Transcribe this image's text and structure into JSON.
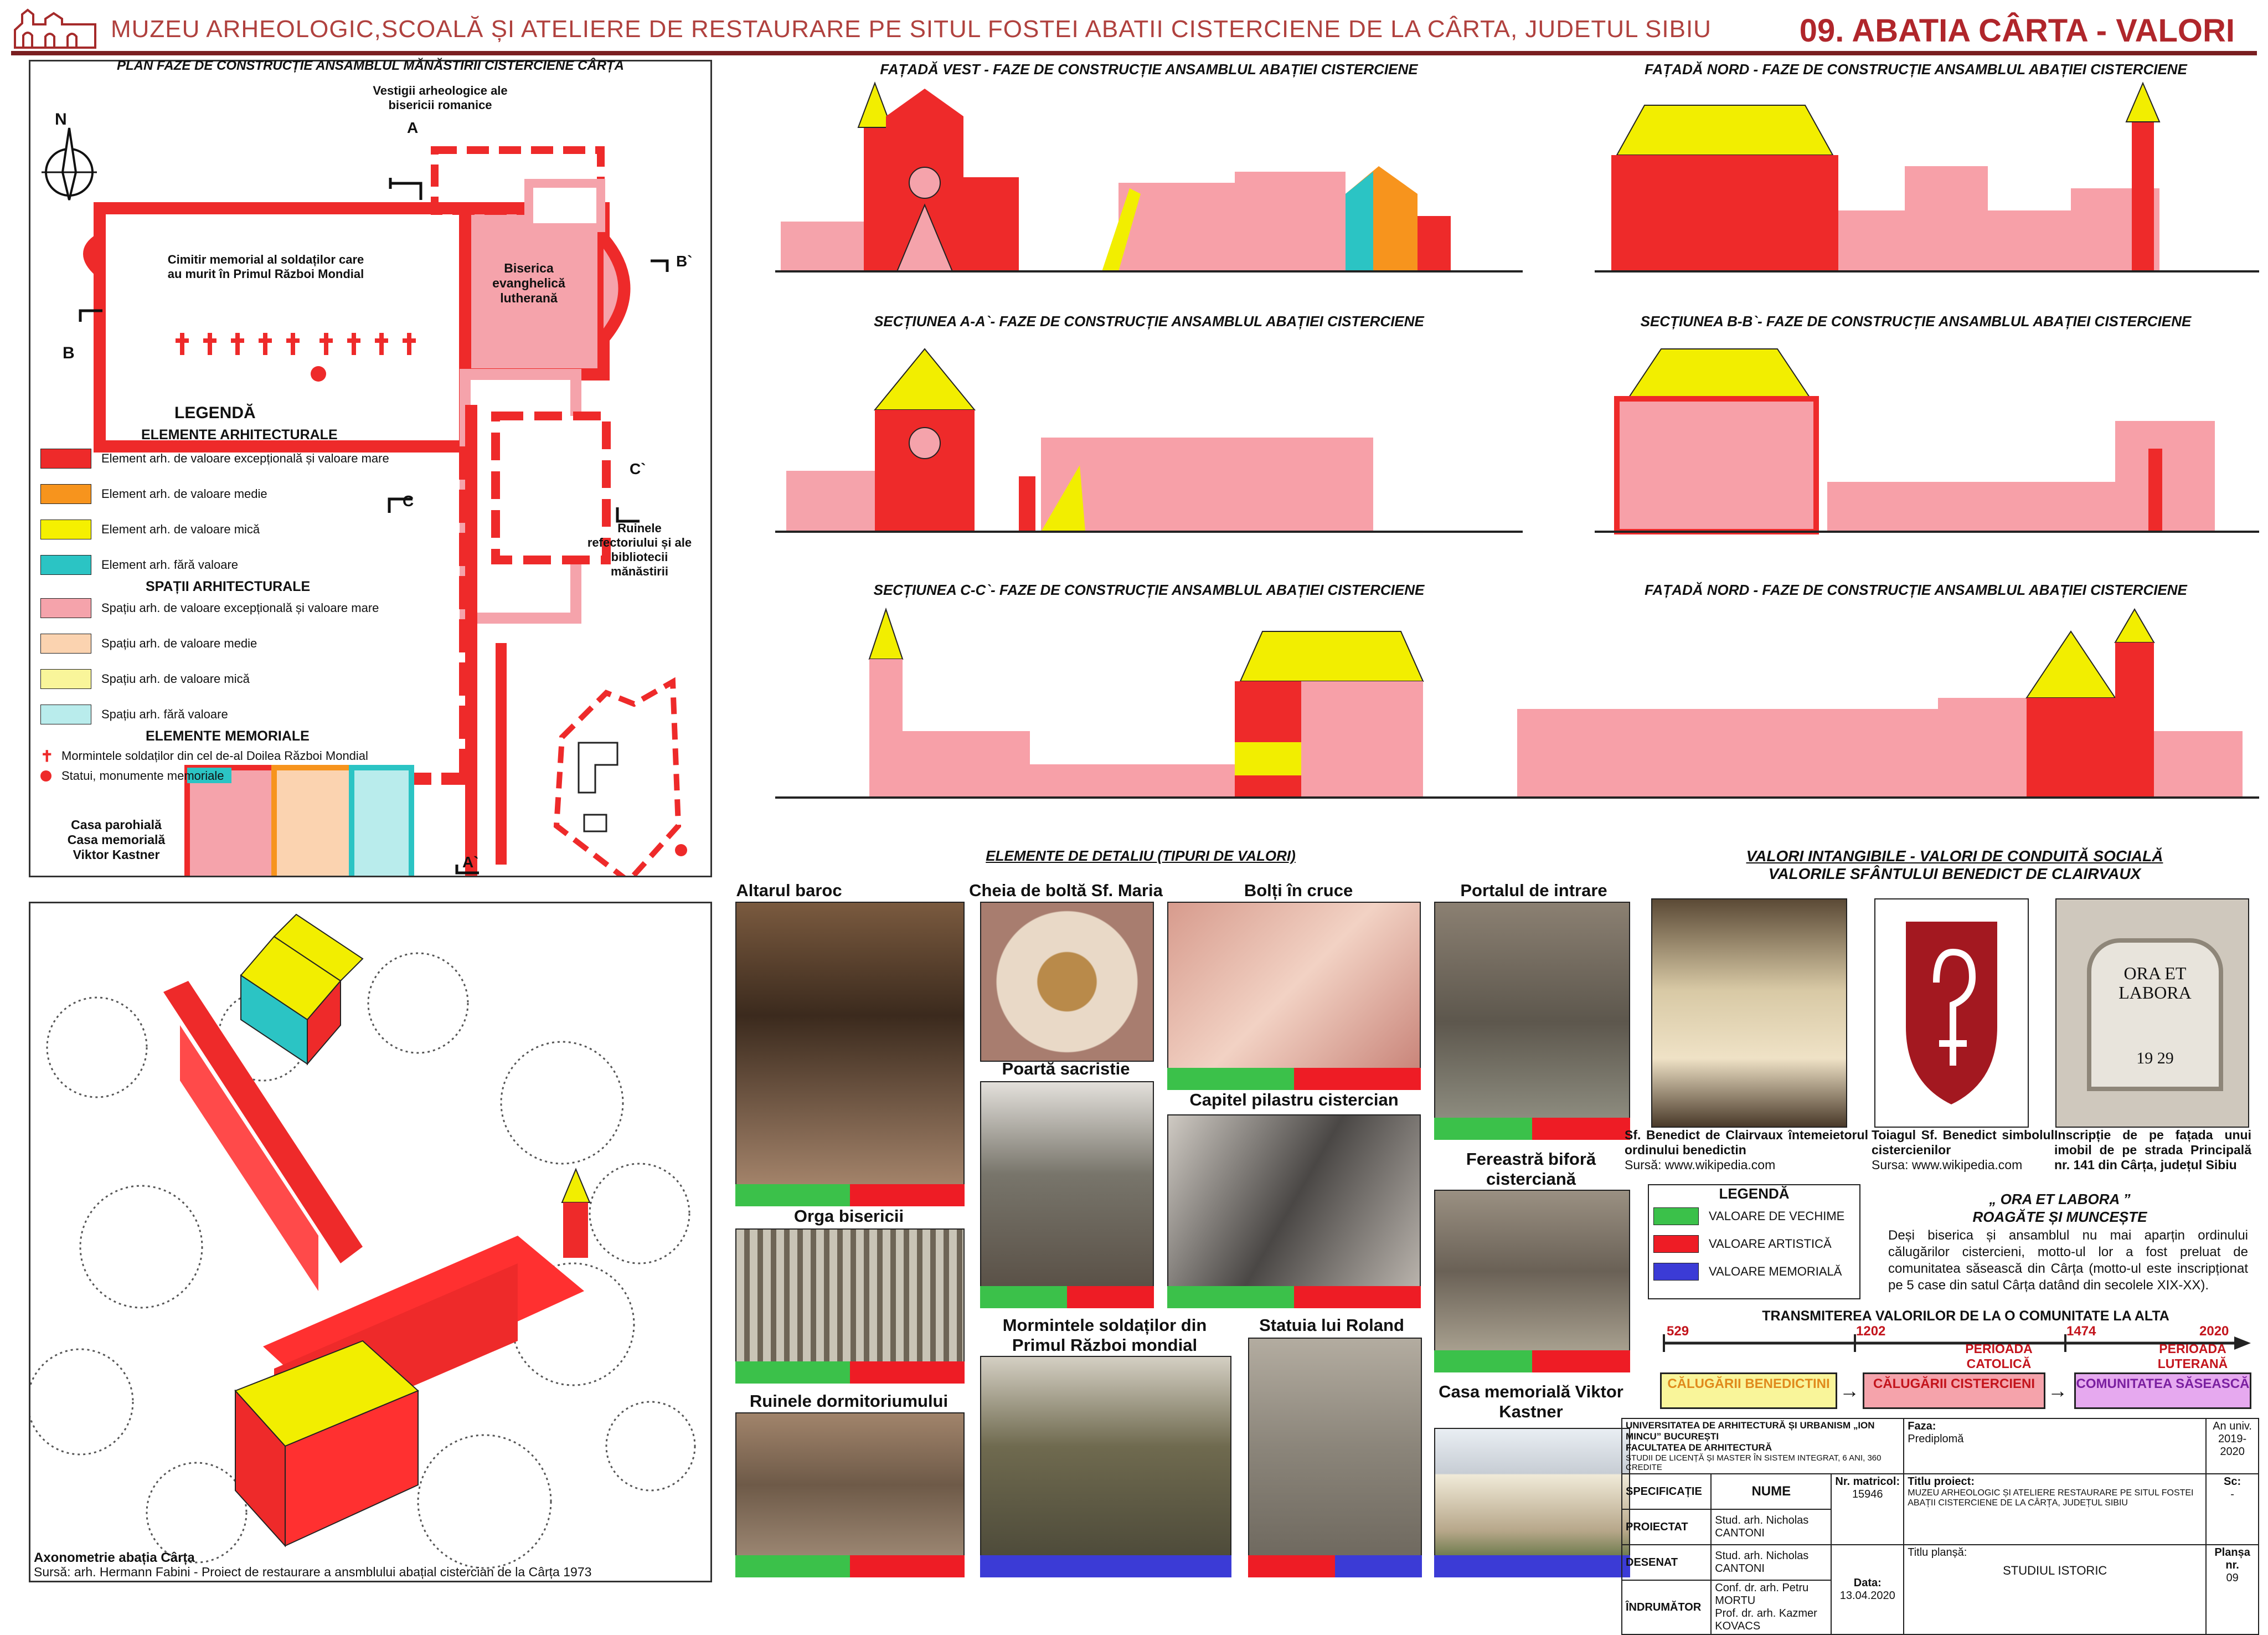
{
  "header": {
    "title": "MUZEU ARHEOLOGIC,SCOALĂ ȘI ATELIERE DE RESTAURARE PE SITUL FOSTEI ABATII CISTERCIENE DE LA CÂRTA, JUDETUL SIBIU",
    "sheet": "09. ABATIA CÂRTA - VALORI"
  },
  "plan": {
    "title": "PLAN FAZE DE CONSTRUCȚIE  ANSAMBLUL MĂNĂSTIRII CISTERCIENE CÂRȚA",
    "vestigii": "Vestigii arheologice ale bisericii romanice",
    "cimitir": "Cimitir memorial al soldaților care au murit  în Primul Război Mondial",
    "biserica": "Biserica evanghelică lutherană",
    "ruinele": "Ruinele refectoriului și ale bibliotecii mănăstirii",
    "casa": "Casa parohială\nCasa memorială\nViktor Kastner",
    "north": "N",
    "cut_a": "A",
    "cut_a2": "A`",
    "cut_b": "B",
    "cut_b2": "B`",
    "cut_c": "C",
    "cut_c2": "C`"
  },
  "legend": {
    "title": "LEGENDĂ",
    "section1": "ELEMENTE ARHITECTURALE",
    "section2": "SPAȚII ARHITECTURALE",
    "section3": "ELEMENTE MEMORIALE",
    "items": [
      {
        "label": "Element arh. de valoare excepțională și valoare mare",
        "color": "#ee2a2a"
      },
      {
        "label": "Element arh. de valoare medie",
        "color": "#f7941d"
      },
      {
        "label": "Element arh. de valoare mică",
        "color": "#f5f000"
      },
      {
        "label": "Element arh. fără valoare",
        "color": "#2bc4c4"
      },
      {
        "label": "Spațiu arh. de valoare excepțională și valoare mare",
        "color": "#f5a3ab"
      },
      {
        "label": "Spațiu arh. de valoare medie",
        "color": "#fbd3b0"
      },
      {
        "label": "Spațiu arh. de valoare mică",
        "color": "#f9f59a"
      },
      {
        "label": "Spațiu arh. fără valoare",
        "color": "#b9ecec"
      }
    ],
    "memorial1": "Mormintele soldaților din cel de-al Doilea Război Mondial",
    "memorial2": "Statui, monumente memoriale"
  },
  "drawings": {
    "d1": "FAȚADĂ VEST - FAZE DE CONSTRUCȚIE ANSAMBLUL ABAȚIEI CISTERCIENE",
    "d2": "FAȚADĂ NORD - FAZE DE CONSTRUCȚIE ANSAMBLUL ABAȚIEI CISTERCIENE",
    "d3": "SECȚIUNEA A-A`- FAZE DE CONSTRUCȚIE ANSAMBLUL ABAȚIEI CISTERCIENE",
    "d4": "SECȚIUNEA B-B`- FAZE DE CONSTRUCȚIE ANSAMBLUL ABAȚIEI CISTERCIENE",
    "d5": "SECȚIUNEA C-C`- FAZE DE CONSTRUCȚIE ANSAMBLUL ABAȚIEI CISTERCIENE",
    "d6": "FAȚADĂ NORD - FAZE DE CONSTRUCȚIE ANSAMBLUL ABAȚIEI CISTERCIENE"
  },
  "axo": {
    "caption": "Axonometrie abația Cârța",
    "source": "Sursă: arh. Hermann Fabini - Proiect de restaurare a ansmblului abațial cistercian de la Cârța 1973"
  },
  "details": {
    "title": "ELEMENTE DE DETALIU  (TIPURI DE VALORI)",
    "photos": [
      {
        "label": "Altarul baroc"
      },
      {
        "label": "Cheia de boltă Sf. Maria"
      },
      {
        "label": "Bolți în cruce"
      },
      {
        "label": "Portalul de intrare"
      },
      {
        "label": "Poartă sacristie"
      },
      {
        "label": "Capitel pilastru cistercian"
      },
      {
        "label": "Orga bisericii"
      },
      {
        "label": "Fereastră biforă cisterciană"
      },
      {
        "label": "Mormintele soldaților din Primul Război mondial"
      },
      {
        "label": "Statuia lui Roland"
      },
      {
        "label": "Ruinele dormitoriumului"
      },
      {
        "label": "Casa memorială Viktor Kastner"
      }
    ]
  },
  "intangible": {
    "title1": "VALORI INTANGIBILE - VALORI DE CONDUITĂ SOCIALĂ",
    "title2": "VALORILE SFÂNTULUI BENEDICT DE CLAIRVAUX",
    "cap1": "Sf.   Benedict   de   Clairvaux întemeietorul ordinului benedictin",
    "src1": "Sursă: www.wikipedia.com",
    "cap2": "Toiagul     Sf.     Benedict simbolul cistercienilor",
    "src2": "Sursa: www.wikipedia.com",
    "cap3": "Inscripție de pe fațada unui imobil de pe strada Principală nr. 141 din Cârța, județul Sibiu",
    "inscription1": "ORA ET",
    "inscription2": "LABORA",
    "inscription3": "19    29",
    "legend_title": "LEGENDĂ",
    "legend": [
      {
        "label": "VALOARE DE VECHIME",
        "color": "#3bc14a"
      },
      {
        "label": "VALOARE ARTISTICĂ",
        "color": "#ee1c25"
      },
      {
        "label": "VALOARE MEMORIALĂ",
        "color": "#3b3bd6"
      }
    ],
    "motto1": "„ ORA ET LABORA ”",
    "motto2": "ROAGĂTE ȘI MUNCEȘTE",
    "body": "Deși biserica și ansamblul nu mai aparțin ordinului călugărilor cistercieni, motto-ul lor  a fost preluat de comunitatea săsească din Cârța (motto-ul este inscripționat pe 5 case din satul Cârța datând din secolele XIX-XX)."
  },
  "timeline": {
    "title": "TRANSMITEREA VALORILOR DE LA O COMUNITATE LA ALTA",
    "years": [
      "529",
      "1202",
      "1474",
      "2020"
    ],
    "period1": "PERIOADA CATOLICĂ",
    "period2": "PERIOADA LUTERANĂ",
    "box1": "CĂLUGĂRII BENEDICTINI",
    "box2": "CĂLUGĂRII CISTERCIENI",
    "box3": "COMUNITATEA SĂSEASCĂ"
  },
  "cartouche": {
    "school": "UNIVERSITATEA DE ARHITECTURĂ ȘI URBANISM „ION MINCU” BUCUREȘTI",
    "faculty": "FACULTATEA DE ARHITECTURĂ",
    "studies": "STUDII DE LICENȚĂ ȘI MASTER ÎN SISTEM INTEGRAT, 6 ANI, 360 CREDITE",
    "faza_label": "Faza:",
    "faza": "Prediplomă",
    "an_label": "An univ.",
    "an": "2019-2020",
    "spec": "SPECIFICAȚIE",
    "nume": "NUME",
    "nr_label": "Nr. matricol:",
    "nr": "15946",
    "titlu_label": "Titlu proiect:",
    "titlu": "MUZEU ARHEOLOGIC ȘI ATELIERE RESTAURARE PE SITUL FOSTEI ABAȚII CISTERCIENE DE LA CÂRȚA, JUDEȚUL SIBIU",
    "sc_label": "Sc:",
    "sc": "-",
    "proiectat": "PROIECTAT",
    "proiectat_name": "Stud. arh. Nicholas CANTONI",
    "desenat": "DESENAT",
    "desenat_name": "Stud. arh. Nicholas CANTONI",
    "data_label": "Data:",
    "data": "13.04.2020",
    "titlu_plansa_label": "Titlu planșă:",
    "titlu_plansa": "STUDIUL ISTORIC",
    "plansa_label": "Planșa nr.",
    "plansa": "09",
    "indrumator": "ÎNDRUMĂTOR",
    "ind1": "Conf. dr. arh. Petru MORTU",
    "ind2": "Prof. dr. arh. Kazmer KOVACS"
  }
}
